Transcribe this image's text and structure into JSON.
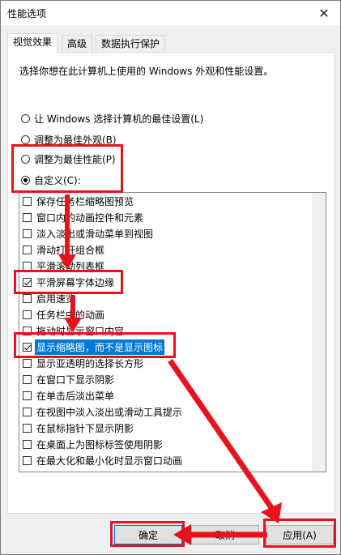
{
  "window": {
    "title": "性能选项"
  },
  "tabs": [
    {
      "label": "视觉效果"
    },
    {
      "label": "高级"
    },
    {
      "label": "数据执行保护"
    }
  ],
  "description": "选择你想在此计算机上使用的 Windows 外观和性能设置。",
  "radios": [
    {
      "label": "让 Windows 选择计算机的最佳设置(L)",
      "checked": false
    },
    {
      "label": "调整为最佳外观(B)",
      "checked": false
    },
    {
      "label": "调整为最佳性能(P)",
      "checked": false
    },
    {
      "label": "自定义(C):",
      "checked": true
    }
  ],
  "options": [
    {
      "label": "保存任务栏缩略图预览",
      "checked": false
    },
    {
      "label": "窗口内的动画控件和元素",
      "checked": false
    },
    {
      "label": "淡入淡出或滑动菜单到视图",
      "checked": false
    },
    {
      "label": "滑动打开组合框",
      "checked": false
    },
    {
      "label": "平滑滚动列表框",
      "checked": false
    },
    {
      "label": "平滑屏幕字体边缘",
      "checked": true
    },
    {
      "label": "启用速览",
      "checked": false
    },
    {
      "label": "任务栏中的动画",
      "checked": false
    },
    {
      "label": "拖动时显示窗口内容",
      "checked": false
    },
    {
      "label": "显示缩略图，而不是显示图标",
      "checked": true,
      "selected": true
    },
    {
      "label": "显示亚透明的选择长方形",
      "checked": false
    },
    {
      "label": "在窗口下显示阴影",
      "checked": false
    },
    {
      "label": "在单击后淡出菜单",
      "checked": false
    },
    {
      "label": "在视图中淡入淡出或滑动工具提示",
      "checked": false
    },
    {
      "label": "在鼠标指针下显示阴影",
      "checked": false
    },
    {
      "label": "在桌面上为图标标签使用阴影",
      "checked": false
    },
    {
      "label": "在最大化和最小化时显示窗口动画",
      "checked": false
    }
  ],
  "buttons": {
    "ok": "确定",
    "cancel": "取消",
    "apply": "应用(A)"
  },
  "colors": {
    "annotation": "#e8121f",
    "selection": "#0078d7"
  }
}
